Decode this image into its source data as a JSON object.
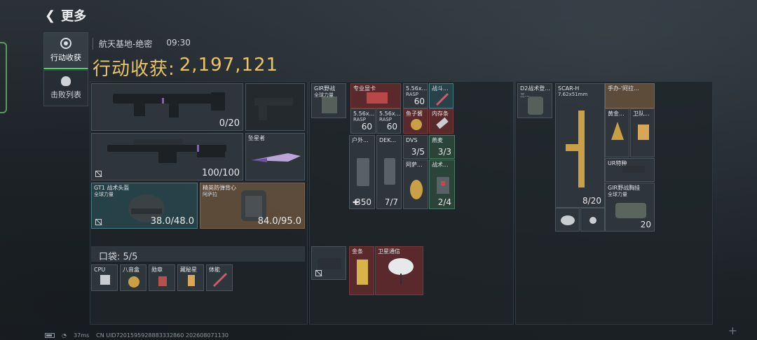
{
  "header": {
    "back_label": "更多",
    "back_icon": "chevron-left-icon"
  },
  "sidebar": [
    {
      "label": "行动收获",
      "icon": "target-icon",
      "active": true
    },
    {
      "label": "击败列表",
      "icon": "skull-icon",
      "active": false
    }
  ],
  "raid": {
    "map": "航天基地-绝密",
    "time": "09:30",
    "title_label": "行动收获:",
    "total_value": "2,197,121"
  },
  "equipment": {
    "primary_weapon": {
      "ammo": "0/20"
    },
    "secondary_weapon": {
      "ammo": "100/100"
    },
    "melee": {
      "name": "坠星者"
    },
    "helmet": {
      "name": "GT1 战术头盔",
      "sub": "全球力量",
      "durability": "38.0/48.0"
    },
    "armor": {
      "name": "精英防弹背心",
      "sub": "阿萨拉",
      "durability": "84.0/95.0"
    }
  },
  "pocket": {
    "label": "口袋: 5/5",
    "items": [
      {
        "name": "CPU"
      },
      {
        "name": "八音盒"
      },
      {
        "name": "勋章"
      },
      {
        "name": "藏秘星"
      },
      {
        "name": "体能"
      }
    ]
  },
  "chest_rig": {
    "name": "GIR野战",
    "sub": "全球力量",
    "items": [
      {
        "name": "专业显卡"
      },
      {
        "name": "5.56x...",
        "sub": "RASP",
        "count": "60"
      },
      {
        "name": "战斗..."
      },
      {
        "name": "5.56x...",
        "sub": "RASP",
        "count": "60"
      },
      {
        "name": "5.56x...",
        "sub": "RASP",
        "count": "60"
      },
      {
        "name": "鱼子酱"
      },
      {
        "name": "内存条"
      },
      {
        "name": "户外...",
        "count": "350"
      },
      {
        "name": "DEK...",
        "count": "7/7"
      },
      {
        "name": "DVS",
        "count": "3/5"
      },
      {
        "name": "燕麦",
        "count": "3/3"
      },
      {
        "name": "阿萨..."
      },
      {
        "name": "战术...",
        "count": "2/4"
      }
    ]
  },
  "case": {
    "items": [
      {
        "name": "金条"
      },
      {
        "name": "卫星通信"
      }
    ]
  },
  "backpack": {
    "name": "D2战术登...",
    "sub": "三...",
    "items": [
      {
        "name": "SCAR-H",
        "sub": "7.62x51mm",
        "count": "8/20"
      },
      {
        "name": "手办-'阿拉..."
      },
      {
        "name": "黄金..."
      },
      {
        "name": "卫队..."
      },
      {
        "name": "UR特种"
      },
      {
        "name": "GIR野战胸挂",
        "sub": "全球力量",
        "count": "20"
      },
      {
        "name": ""
      },
      {
        "name": ""
      }
    ]
  },
  "status_bar": {
    "ping": "37ms",
    "uid": "CN UID7201595928883332860 202608071130"
  },
  "colors": {
    "accent_gold": "#e9c56a",
    "active_green": "#4fd46b",
    "rarity_red": "#7a3a3c",
    "rarity_gold": "#7a6350"
  }
}
